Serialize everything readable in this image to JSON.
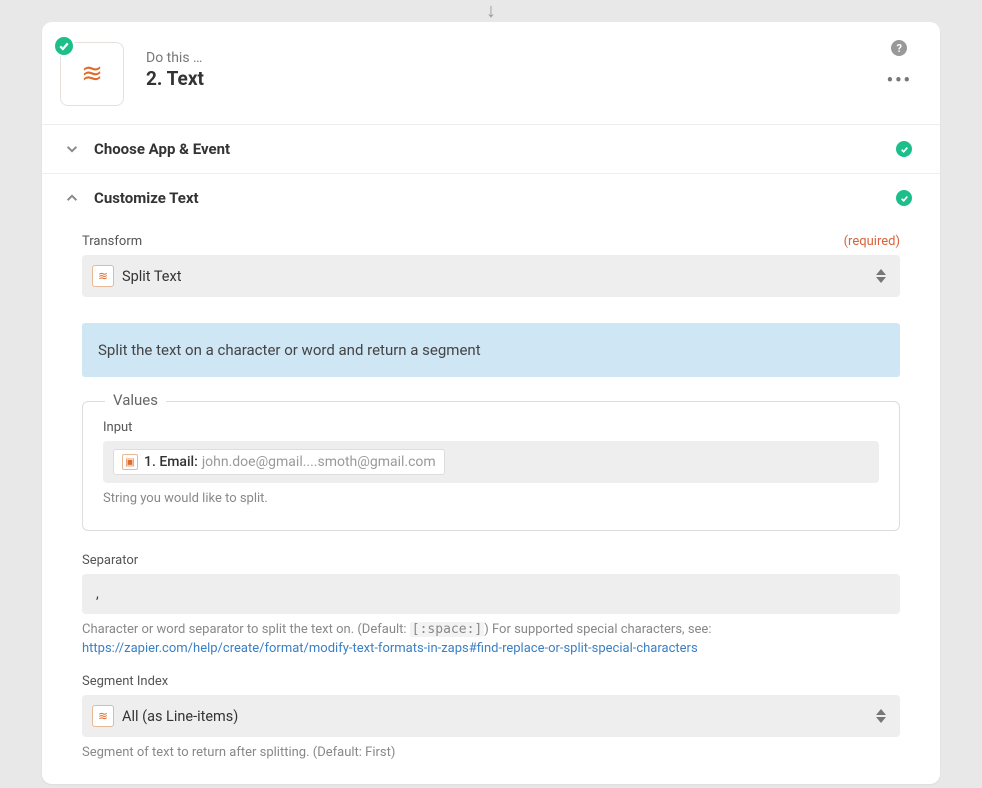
{
  "header": {
    "subtitle": "Do this …",
    "title": "2. Text"
  },
  "sections": {
    "choose": "Choose App & Event",
    "customize": "Customize Text"
  },
  "transform": {
    "label": "Transform",
    "required": "(required)",
    "value": "Split Text",
    "info": "Split the text on a character or word and return a segment"
  },
  "values": {
    "legend": "Values",
    "input_label": "Input",
    "pill_prefix": "1. Email:",
    "pill_value": "john.doe@gmail....smoth@gmail.com",
    "input_help": "String you would like to split."
  },
  "separator": {
    "label": "Separator",
    "value": ",",
    "help_pre": "Character or word separator to split the text on. (Default: ",
    "help_code": "[:space:]",
    "help_post": ") For supported special characters, see:",
    "link": "https://zapier.com/help/create/format/modify-text-formats-in-zaps#find-replace-or-split-special-characters"
  },
  "segment": {
    "label": "Segment Index",
    "value": "All (as Line-items)",
    "help": "Segment of text to return after splitting. (Default: First)"
  }
}
